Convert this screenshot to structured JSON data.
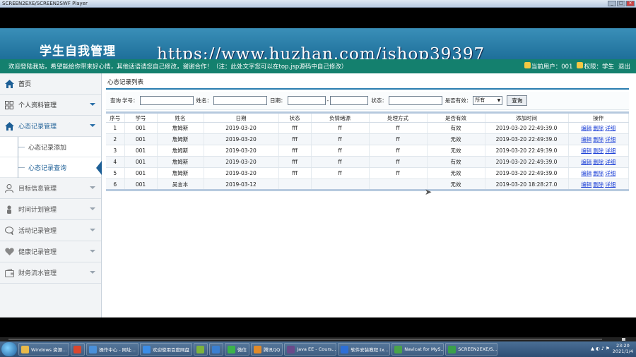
{
  "player": {
    "title": "SCREEN2EXE/SCREEN2SWF Player",
    "min": "_",
    "max": "□",
    "close": "×"
  },
  "header": {
    "system_title": "学生自我管理",
    "watermark": "https://www.huzhan.com/ishop39397",
    "notice": "欢迎登陆我站，希望能给你带来好心情，其他话语请您自己修改，谢谢合作！（注：此处文字您可以在top.jsp源码中自己修改）",
    "current_user": "当前用户：001",
    "role": "权限：学生",
    "logout": "退出"
  },
  "sidebar": {
    "items": [
      {
        "label": "首页",
        "icon": "home-icon"
      },
      {
        "label": "个人资料管理",
        "icon": "grid-icon"
      },
      {
        "label": "心态记录管理",
        "icon": "home-icon"
      },
      {
        "label": "目标信息管理",
        "icon": "user-icon"
      },
      {
        "label": "时间计划管理",
        "icon": "person-icon"
      },
      {
        "label": "活动记录管理",
        "icon": "chat-icon"
      },
      {
        "label": "健康记录管理",
        "icon": "heart-icon"
      },
      {
        "label": "财务流水管理",
        "icon": "wallet-icon"
      }
    ],
    "subitems": [
      {
        "label": "心态记录添加"
      },
      {
        "label": "心态记录查询"
      }
    ]
  },
  "content": {
    "panel_title": "心态记录列表",
    "search": {
      "label_prefix": "查询",
      "student_no_label": "学号：",
      "name_label": "姓名：",
      "date_label": "日期：",
      "date_sep": "-",
      "status_label": "状态：",
      "valid_label": "是否有效：",
      "valid_value": "所有",
      "query_button": "查询"
    },
    "table": {
      "columns": [
        "序号",
        "学号",
        "姓名",
        "日期",
        "状态",
        "负情绪源",
        "处理方式",
        "是否有效",
        "添加时间",
        "操作"
      ],
      "rows": [
        {
          "idx": "1",
          "sno": "001",
          "name": "詹姆斯",
          "date": "2019-03-20",
          "status": "fff",
          "source": "ff",
          "method": "ff",
          "valid": "有效",
          "time": "2019-03-20 22:49:39.0"
        },
        {
          "idx": "2",
          "sno": "001",
          "name": "詹姆斯",
          "date": "2019-03-20",
          "status": "fff",
          "source": "ff",
          "method": "ff",
          "valid": "无效",
          "time": "2019-03-20 22:49:39.0"
        },
        {
          "idx": "3",
          "sno": "001",
          "name": "詹姆斯",
          "date": "2019-03-20",
          "status": "fff",
          "source": "ff",
          "method": "ff",
          "valid": "无效",
          "time": "2019-03-20 22:49:39.0"
        },
        {
          "idx": "4",
          "sno": "001",
          "name": "詹姆斯",
          "date": "2019-03-20",
          "status": "fff",
          "source": "ff",
          "method": "ff",
          "valid": "有效",
          "time": "2019-03-20 22:49:39.0"
        },
        {
          "idx": "5",
          "sno": "001",
          "name": "詹姆斯",
          "date": "2019-03-20",
          "status": "fff",
          "source": "ff",
          "method": "ff",
          "valid": "无效",
          "time": "2019-03-20 22:49:39.0"
        },
        {
          "idx": "6",
          "sno": "001",
          "name": "吴言本",
          "date": "2019-03-12",
          "status": "",
          "source": "",
          "method": "",
          "valid": "无效",
          "time": "2019-03-20 18:28:27.0"
        }
      ],
      "actions": [
        "编辑",
        "删除",
        "详细"
      ]
    }
  },
  "taskbar": {
    "items": [
      {
        "label": "Windows 资源...",
        "color": "#e8b94a"
      },
      {
        "label": "",
        "color": "#d9462e"
      },
      {
        "label": "操作中心 - 网址...",
        "color": "#4a90d9"
      },
      {
        "label": "欢迎使用百度网盘",
        "color": "#3c8de6"
      },
      {
        "label": "",
        "color": "#7db33c"
      },
      {
        "label": "",
        "color": "#3a7fd0"
      },
      {
        "label": "微信",
        "color": "#3cb34a"
      },
      {
        "label": "腾讯QQ",
        "color": "#e08a2a"
      },
      {
        "label": "Java EE - Cours...",
        "color": "#6a4a8a"
      },
      {
        "label": "软件安装教程.tx...",
        "color": "#2d6fd6"
      },
      {
        "label": "Navicat for MyS...",
        "color": "#4aa34a"
      },
      {
        "label": "SCREEN2EXE/S...",
        "color": "#3aa04a"
      }
    ],
    "time": "23:20",
    "date": "2021/1/4"
  }
}
